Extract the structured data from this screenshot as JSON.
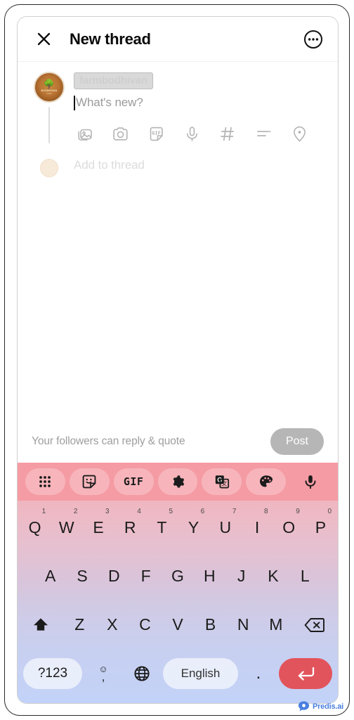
{
  "header": {
    "title": "New thread",
    "close_icon": "close-icon",
    "more_icon": "more-options-icon"
  },
  "compose": {
    "username": "farmbodhivan",
    "username_redacted": true,
    "avatar_brand": "BODHIVAN",
    "avatar_sub": "FARM",
    "placeholder": "What's new?",
    "text_value": "",
    "add_to_thread_label": "Add to thread",
    "attachments": [
      {
        "name": "gallery-icon",
        "label": "Add photo"
      },
      {
        "name": "camera-icon",
        "label": "Camera"
      },
      {
        "name": "gif-icon",
        "label": "GIF"
      },
      {
        "name": "microphone-icon",
        "label": "Voice"
      },
      {
        "name": "hashtag-icon",
        "label": "Tag"
      },
      {
        "name": "poll-icon",
        "label": "Poll"
      },
      {
        "name": "location-icon",
        "label": "Location"
      }
    ]
  },
  "footer": {
    "reply_note": "Your followers can reply & quote",
    "post_label": "Post",
    "post_enabled": false,
    "post_color": "#b6b6b6"
  },
  "keyboard": {
    "toolbar": [
      {
        "name": "apps-grid-icon",
        "label": ""
      },
      {
        "name": "sticker-icon",
        "label": ""
      },
      {
        "name": "gif-icon",
        "label": "GIF"
      },
      {
        "name": "settings-gear-icon",
        "label": ""
      },
      {
        "name": "google-translate-icon",
        "label": ""
      },
      {
        "name": "theme-palette-icon",
        "label": ""
      },
      {
        "name": "microphone-icon",
        "label": ""
      }
    ],
    "row1": [
      {
        "key": "Q",
        "num": "1"
      },
      {
        "key": "W",
        "num": "2"
      },
      {
        "key": "E",
        "num": "3"
      },
      {
        "key": "R",
        "num": "4"
      },
      {
        "key": "T",
        "num": "5"
      },
      {
        "key": "Y",
        "num": "6"
      },
      {
        "key": "U",
        "num": "7"
      },
      {
        "key": "I",
        "num": "8"
      },
      {
        "key": "O",
        "num": "9"
      },
      {
        "key": "P",
        "num": "0"
      }
    ],
    "row2": [
      "A",
      "S",
      "D",
      "F",
      "G",
      "H",
      "J",
      "K",
      "L"
    ],
    "row3": [
      "Z",
      "X",
      "C",
      "V",
      "B",
      "N",
      "M"
    ],
    "shift_icon": "shift-icon",
    "backspace_icon": "backspace-icon",
    "numbers_label": "?123",
    "emoji_icon": "emoji-icon",
    "comma_label": ",",
    "globe_icon": "language-globe-icon",
    "space_label": "English",
    "period_label": ".",
    "enter_icon": "enter-icon",
    "enter_color": "#e2545c",
    "toolbar_color": "#f59ba4"
  },
  "watermark": {
    "text": "Predis.ai",
    "color": "#4a7fe0"
  }
}
